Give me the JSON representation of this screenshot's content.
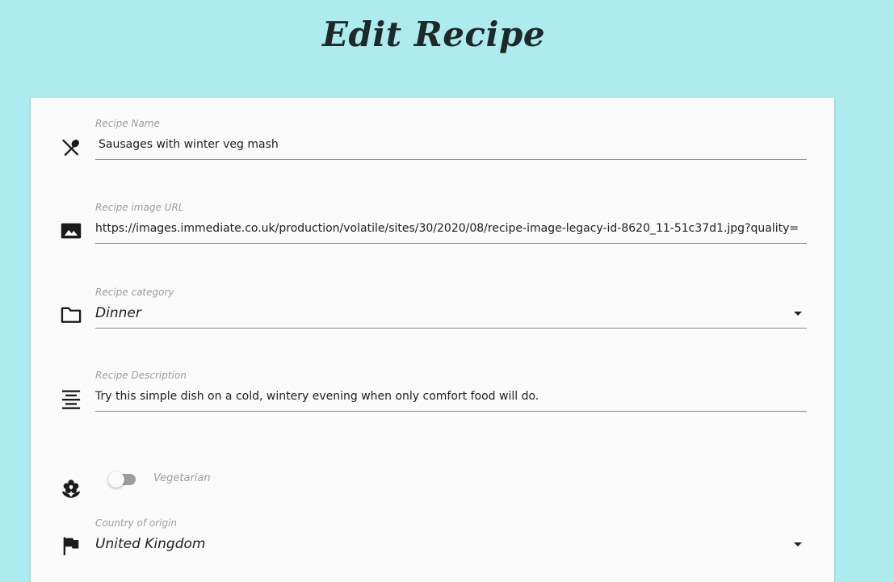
{
  "page": {
    "title": "Edit Recipe"
  },
  "form": {
    "recipe_name": {
      "label": "Recipe Name",
      "value": "Sausages with winter veg mash",
      "icon": "cutlery-icon"
    },
    "image_url": {
      "label": "Recipe image URL",
      "value": "https://images.immediate.co.uk/production/volatile/sites/30/2020/08/recipe-image-legacy-id-8620_11-51c37d1.jpg?quality=",
      "icon": "image-icon"
    },
    "category": {
      "label": "Recipe category",
      "value": "Dinner",
      "icon": "folder-icon"
    },
    "description": {
      "label": "Recipe Description",
      "value": "Try this simple dish on a cold, wintery evening when only comfort food will do.",
      "icon": "align-center-icon"
    },
    "vegetarian": {
      "label": "Vegetarian",
      "checked": false,
      "icon": "flower-icon"
    },
    "country": {
      "label": "Country of origin",
      "value": "United Kingdom",
      "icon": "flag-icon"
    }
  },
  "colors": {
    "background": "#aeebee",
    "card": "#fafafa",
    "label": "#9e9e9e",
    "text": "#212121"
  }
}
